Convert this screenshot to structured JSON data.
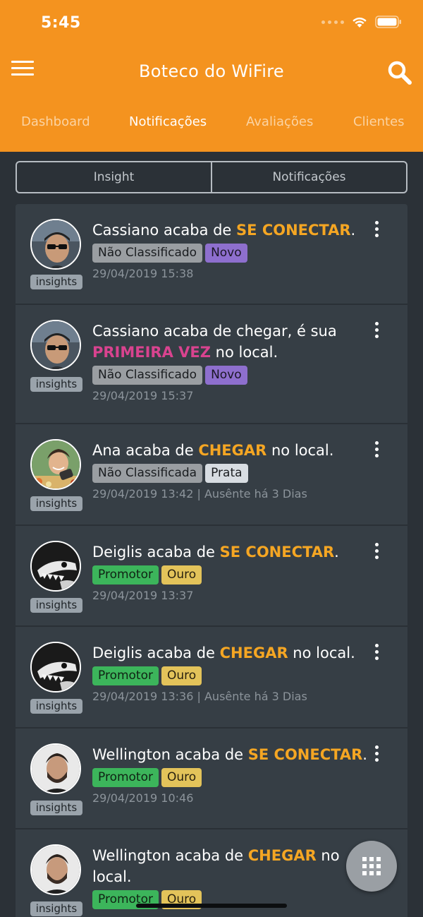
{
  "status_bar": {
    "time": "5:45"
  },
  "app_bar": {
    "title": "Boteco do WiFire"
  },
  "tabs": [
    {
      "label": "Dashboard"
    },
    {
      "label": "Notificações"
    },
    {
      "label": "Avaliações"
    },
    {
      "label": "Clientes"
    }
  ],
  "active_tab": "Notificações",
  "segments": [
    {
      "label": "Insight"
    },
    {
      "label": "Notificações"
    }
  ],
  "insights_label": "insights",
  "notifications": [
    {
      "avatar": "avatar-cassiano",
      "message_parts": [
        {
          "text": "Cassiano acaba de ",
          "style": "normal"
        },
        {
          "text": "SE CONECTAR",
          "style": "orange"
        },
        {
          "text": ".",
          "style": "normal"
        }
      ],
      "tags": [
        {
          "label": "Não Classificado",
          "color": "gray"
        },
        {
          "label": "Novo",
          "color": "purple"
        }
      ],
      "time": "29/04/2019 15:38"
    },
    {
      "avatar": "avatar-cassiano",
      "message_parts": [
        {
          "text": "Cassiano acaba de chegar, é sua ",
          "style": "normal"
        },
        {
          "text": "PRIMEIRA VEZ",
          "style": "pink"
        },
        {
          "text": " no local.",
          "style": "normal"
        }
      ],
      "tags": [
        {
          "label": "Não Classificado",
          "color": "gray"
        },
        {
          "label": "Novo",
          "color": "purple"
        }
      ],
      "time": "29/04/2019 15:37"
    },
    {
      "avatar": "avatar-ana",
      "message_parts": [
        {
          "text": "Ana acaba de ",
          "style": "normal"
        },
        {
          "text": "CHEGAR",
          "style": "orange"
        },
        {
          "text": " no local.",
          "style": "normal"
        }
      ],
      "tags": [
        {
          "label": "Não Classificada",
          "color": "gray"
        },
        {
          "label": "Prata",
          "color": "silver"
        }
      ],
      "time": "29/04/2019 13:42 | Ausênte há 3 Dias"
    },
    {
      "avatar": "avatar-deiglis",
      "message_parts": [
        {
          "text": "Deiglis acaba de ",
          "style": "normal"
        },
        {
          "text": "SE CONECTAR",
          "style": "orange"
        },
        {
          "text": ".",
          "style": "normal"
        }
      ],
      "tags": [
        {
          "label": "Promotor",
          "color": "green"
        },
        {
          "label": "Ouro",
          "color": "gold"
        }
      ],
      "time": "29/04/2019 13:37"
    },
    {
      "avatar": "avatar-deiglis",
      "message_parts": [
        {
          "text": "Deiglis acaba de ",
          "style": "normal"
        },
        {
          "text": "CHEGAR",
          "style": "orange"
        },
        {
          "text": " no local.",
          "style": "normal"
        }
      ],
      "tags": [
        {
          "label": "Promotor",
          "color": "green"
        },
        {
          "label": "Ouro",
          "color": "gold"
        }
      ],
      "time": "29/04/2019 13:36 | Ausênte há 3 Dias"
    },
    {
      "avatar": "avatar-wellington",
      "message_parts": [
        {
          "text": "Wellington acaba de ",
          "style": "normal"
        },
        {
          "text": "SE CONECTAR",
          "style": "orange"
        },
        {
          "text": ".",
          "style": "normal"
        }
      ],
      "tags": [
        {
          "label": "Promotor",
          "color": "green"
        },
        {
          "label": "Ouro",
          "color": "gold"
        }
      ],
      "time": "29/04/2019 10:46"
    },
    {
      "avatar": "avatar-wellington",
      "message_parts": [
        {
          "text": "Wellington acaba de ",
          "style": "normal"
        },
        {
          "text": "CHEGAR",
          "style": "orange"
        },
        {
          "text": " no local.",
          "style": "normal"
        }
      ],
      "tags": [
        {
          "label": "Promotor",
          "color": "green"
        },
        {
          "label": "Ouro",
          "color": "gold"
        }
      ],
      "time": ""
    }
  ],
  "colors": {
    "header": "#f4931f",
    "background": "#2b3137",
    "card": "#363e45",
    "highlight_orange": "#f5a623",
    "highlight_pink": "#d9438f"
  },
  "icons": {
    "menu": "hamburger-menu-icon",
    "search": "search-icon",
    "more": "more-vertical-icon",
    "fab": "grid-icon"
  }
}
